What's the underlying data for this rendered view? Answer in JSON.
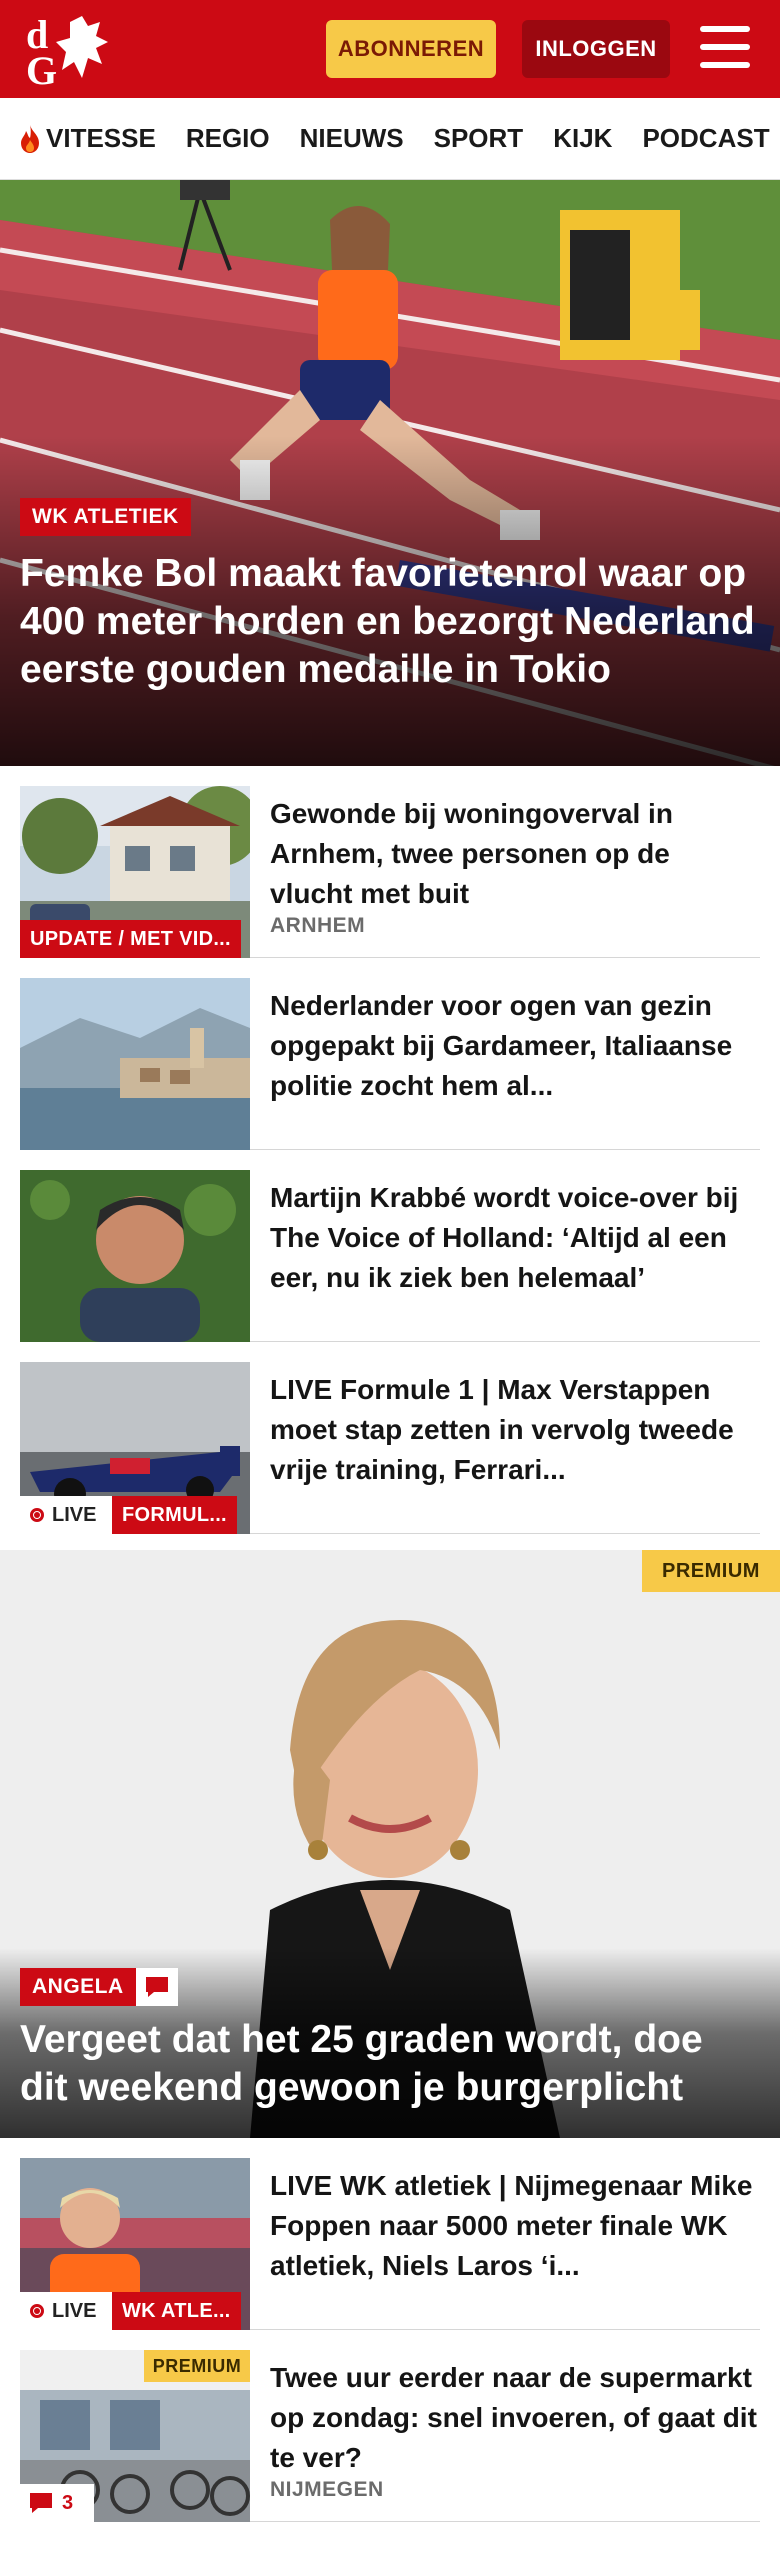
{
  "header": {
    "logo_text": "dG",
    "subscribe_label": "ABONNEREN",
    "login_label": "INLOGGEN",
    "brand_color": "#cc0a14"
  },
  "nav": {
    "items": [
      {
        "label": "VITESSE",
        "icon": "flame-icon"
      },
      {
        "label": "REGIO"
      },
      {
        "label": "NIEUWS"
      },
      {
        "label": "SPORT"
      },
      {
        "label": "KIJK"
      },
      {
        "label": "PODCAST"
      }
    ]
  },
  "hero": {
    "tag": "WK ATLETIEK",
    "title": "Femke Bol maakt favorietenrol waar op 400 meter horden en bezorgt Nederland eerste gouden medaille in Tokio"
  },
  "articles": [
    {
      "title": "Gewonde bij woningoverval in Arnhem, twee personen op de vlucht met buit",
      "meta": "ARNHEM",
      "thumb_tag": "UPDATE / MET VID..."
    },
    {
      "title": "Nederlander voor ogen van gezin opgepakt bij Gardameer, Italiaanse politie zocht hem al..."
    },
    {
      "title": "Martijn Krabbé wordt voice-over bij The Voice of Holland: ‘Altijd al een eer, nu ik ziek ben helemaal’"
    },
    {
      "title": "LIVE Formule 1 | Max Verstappen moet stap zetten in vervolg tweede vrije training, Ferrari...",
      "live_label": "LIVE",
      "thumb_tag": "FORMUL..."
    }
  ],
  "feature": {
    "premium_label": "PREMIUM",
    "tag": "ANGELA",
    "title": "Vergeet dat het 25 graden wordt, doe dit weekend gewoon je burgerplicht"
  },
  "articles2": [
    {
      "title": "LIVE WK atletiek | Nijmegenaar Mike Foppen naar 5000 meter finale WK atletiek, Niels Laros ‘i...",
      "live_label": "LIVE",
      "thumb_tag": "WK ATLE..."
    },
    {
      "title": "Twee uur eerder naar de supermarkt op zondag: snel invoeren, of gaat dit te ver?",
      "meta": "NIJMEGEN",
      "premium_label": "PREMIUM",
      "comment_count": "3"
    }
  ]
}
